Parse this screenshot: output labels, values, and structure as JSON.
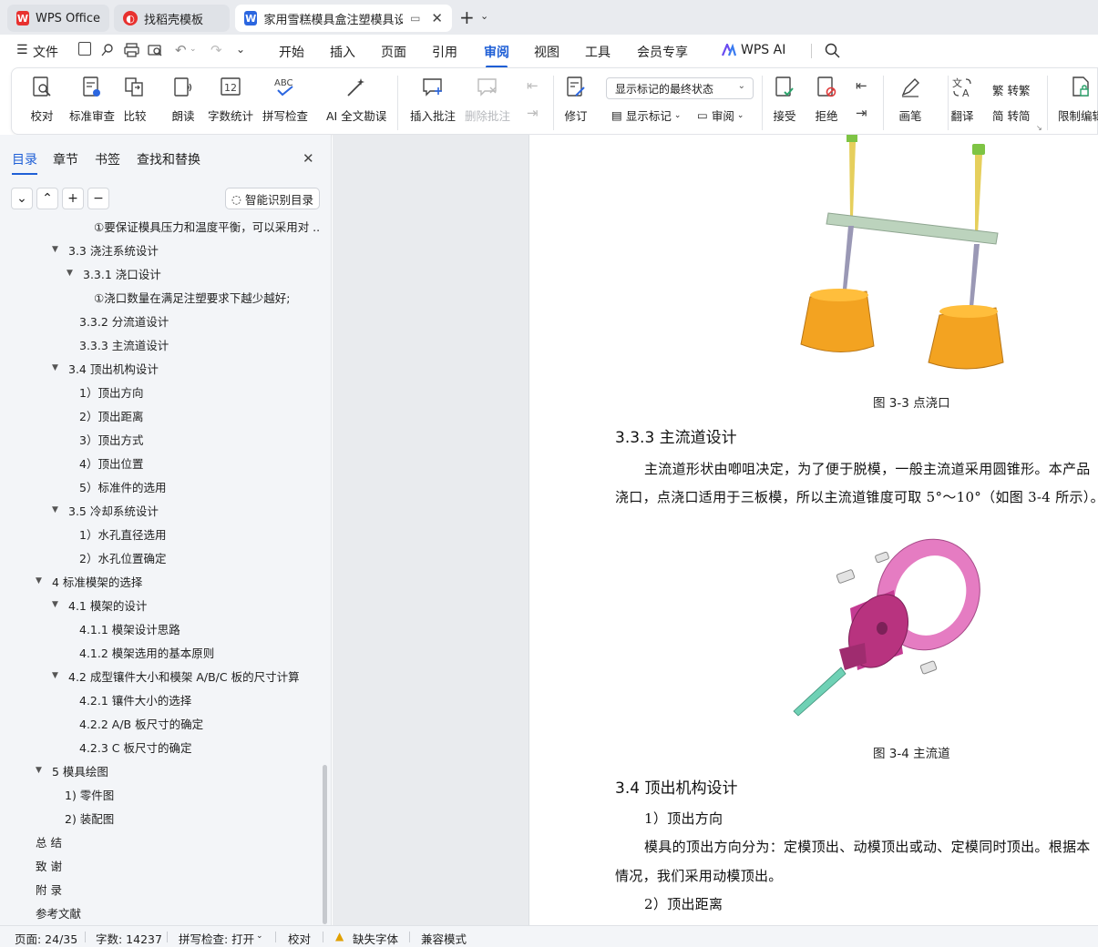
{
  "tabs": [
    {
      "label": "WPS Office"
    },
    {
      "label": "找稻壳模板"
    },
    {
      "label": "家用雪糕模具盒注塑模具设计"
    }
  ],
  "menu": {
    "file_label": "文件",
    "items": [
      "开始",
      "插入",
      "页面",
      "引用",
      "审阅",
      "视图",
      "工具",
      "会员专享",
      "WPS AI"
    ],
    "active": "审阅"
  },
  "ribbon": {
    "proofread": "校对",
    "standard_review": "标准审查",
    "compare": "比较",
    "read_aloud": "朗读",
    "word_count": "字数统计",
    "spell_check": "拼写检查",
    "ai_proof": "AI 全文勘误",
    "insert_comment": "插入批注",
    "delete_comment": "删除批注",
    "revise": "修订",
    "markup_state": "显示标记的最终状态",
    "show_markup": "显示标记",
    "review": "审阅",
    "accept": "接受",
    "reject": "拒绝",
    "pen": "画笔",
    "translate": "翻译",
    "to_traditional": "转繁",
    "to_simplified": "转简",
    "restrict_edit": "限制编辑"
  },
  "nav": {
    "tabs": [
      "目录",
      "章节",
      "书签",
      "查找和替换"
    ],
    "smart_toc": "智能识别目录",
    "toc": [
      {
        "text": "①要保证模具压力和温度平衡，可以采用对 ...",
        "level": 4,
        "arrow": false
      },
      {
        "text": "3.3  浇注系统设计",
        "level": 2,
        "arrow": true
      },
      {
        "text": "3.3.1  浇口设计",
        "level": 3,
        "arrow": true
      },
      {
        "text": "①浇口数量在满足注塑要求下越少越好;",
        "level": 4,
        "arrow": false
      },
      {
        "text": "3.3.2  分流道设计",
        "level": 3,
        "arrow": false
      },
      {
        "text": "3.3.3  主流道设计",
        "level": 3,
        "arrow": false
      },
      {
        "text": "3.4  顶出机构设计",
        "level": 2,
        "arrow": true
      },
      {
        "text": "1）顶出方向",
        "level": 3,
        "arrow": false
      },
      {
        "text": "2）顶出距离",
        "level": 3,
        "arrow": false
      },
      {
        "text": "3）顶出方式",
        "level": 3,
        "arrow": false
      },
      {
        "text": "4）顶出位置",
        "level": 3,
        "arrow": false
      },
      {
        "text": "5）标准件的选用",
        "level": 3,
        "arrow": false
      },
      {
        "text": "3.5  冷却系统设计",
        "level": 2,
        "arrow": true
      },
      {
        "text": "1）水孔直径选用",
        "level": 3,
        "arrow": false
      },
      {
        "text": "2）水孔位置确定",
        "level": 3,
        "arrow": false
      },
      {
        "text": "4  标准模架的选择",
        "level": 1,
        "arrow": true
      },
      {
        "text": "4.1 模架的设计",
        "level": 2,
        "arrow": true
      },
      {
        "text": "4.1.1  模架设计思路",
        "level": 3,
        "arrow": false
      },
      {
        "text": "4.1.2  模架选用的基本原则",
        "level": 3,
        "arrow": false
      },
      {
        "text": "4.2  成型镶件大小和模架 A/B/C 板的尺寸计算",
        "level": 2,
        "arrow": true
      },
      {
        "text": "4.2.1  镶件大小的选择",
        "level": 3,
        "arrow": false
      },
      {
        "text": "4.2.2    A/B 板尺寸的确定",
        "level": 3,
        "arrow": false
      },
      {
        "text": "4.2.3    C 板尺寸的确定",
        "level": 3,
        "arrow": false
      },
      {
        "text": "5  模具绘图",
        "level": 1,
        "arrow": true
      },
      {
        "text": "1)    零件图",
        "level": 2,
        "arrow": false
      },
      {
        "text": "2)    装配图",
        "level": 2,
        "arrow": false
      },
      {
        "text": "总  结",
        "level": 0,
        "arrow": false
      },
      {
        "text": "致  谢",
        "level": 0,
        "arrow": false
      },
      {
        "text": "附  录",
        "level": 0,
        "arrow": false
      },
      {
        "text": "参考文献",
        "level": 0,
        "arrow": false
      }
    ]
  },
  "doc": {
    "fig33_caption": "图 3-3 点浇口",
    "h333": "3.3.3  主流道设计",
    "p1_line1": "主流道形状由喞咀决定，为了便于脱模，一般主流道采用圆锥形。本产品",
    "p1_line2": "浇口，点浇口适用于三板模，所以主流道锥度可取 5°～10°（如图 3-4 所示）。",
    "fig34_caption": "图 3-4 主流道",
    "h34": "3.4  顶出机构设计",
    "sub1": "1）顶出方向",
    "p2_line1": "模具的顶出方向分为：定模顶出、动模顶出或动、定模同时顶出。根据本",
    "p2_line2": "情况，我们采用动模顶出。",
    "sub2": "2）顶出距离"
  },
  "status": {
    "page": "页面: 24/35",
    "words": "字数: 14237",
    "spell": "拼写检查: 打开",
    "proof": "校对",
    "missing_font": "缺失字体",
    "compat": "兼容模式"
  }
}
